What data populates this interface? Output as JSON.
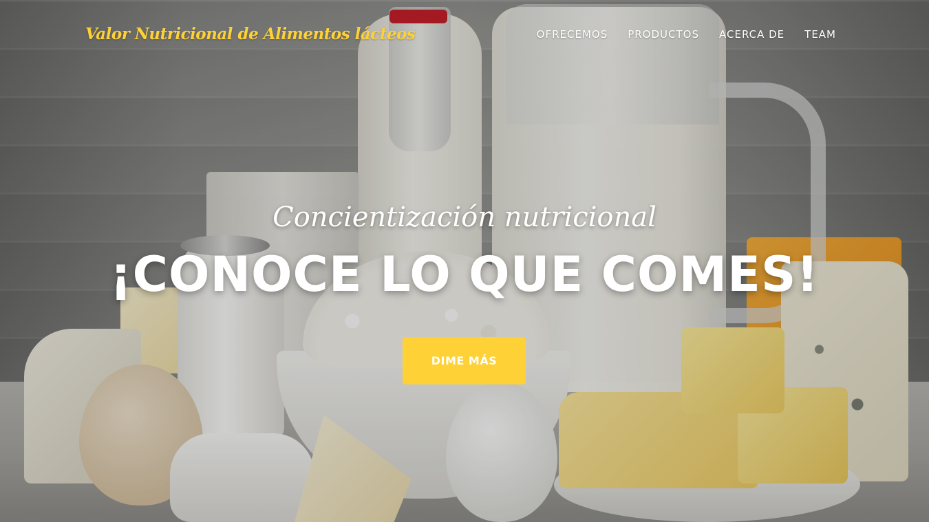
{
  "navbar": {
    "brand": "Valor Nutricional de Alimentos lácteos",
    "items": [
      {
        "label": "OFRECEMOS"
      },
      {
        "label": "PRODUCTOS"
      },
      {
        "label": "ACERCA DE"
      },
      {
        "label": "TEAM"
      }
    ]
  },
  "hero": {
    "subheading": "Concientización nutricional",
    "heading": "¡CONOCE LO QUE COMES!",
    "cta_label": "DIME MÁS"
  },
  "colors": {
    "accent": "#fed136",
    "text": "#ffffff"
  }
}
